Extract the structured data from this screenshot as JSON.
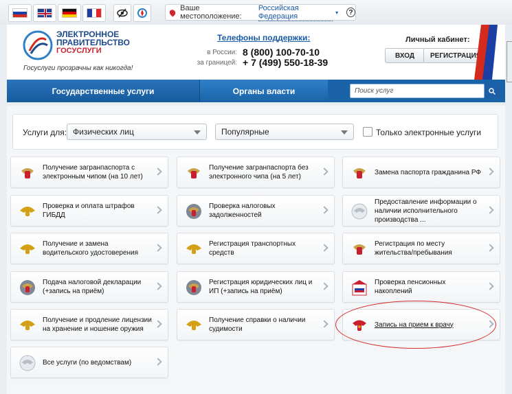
{
  "location": {
    "label": "Ваше местоположение:",
    "value": "Российская Федерация",
    "help": "?"
  },
  "logo": {
    "line1": "ЭЛЕКТРОННОЕ",
    "line2": "ПРАВИТЕЛЬСТВО",
    "line3": "ГОСУСЛУГИ",
    "slogan": "Госуслуги прозрачны как никогда!"
  },
  "support": {
    "title": "Телефоны поддержки:",
    "russia_label": "в России:",
    "russia_number": "8 (800) 100-70-10",
    "abroad_label": "за границей:",
    "abroad_number": "+ 7 (499) 550-18-39"
  },
  "cabinet": {
    "title": "Личный кабинет:",
    "login": "ВХОД",
    "register": "РЕГИСТРАЦИЯ"
  },
  "nav": {
    "services": "Государственные услуги",
    "authorities": "Органы власти",
    "search_placeholder": "Поиск услуг"
  },
  "filter": {
    "label": "Услуги для:",
    "audience": "Физических лиц",
    "sort": "Популярные",
    "electronic_only": "Только электронные услуги"
  },
  "services": [
    {
      "label": "Получение загранпаспорта с электронным чипом (на 10 лет)",
      "icon": "emblem-red"
    },
    {
      "label": "Получение загранпаспорта без электронного чипа (на 5 лет)",
      "icon": "emblem-red"
    },
    {
      "label": "Замена паспорта гражданина РФ",
      "icon": "emblem-red"
    },
    {
      "label": "Проверка и оплата штрафов ГИБДД",
      "icon": "emblem-gold"
    },
    {
      "label": "Проверка налоговых задолженностей",
      "icon": "emblem-tax"
    },
    {
      "label": "Предоставление информации о наличии исполнительного производства ...",
      "icon": "emblem-gray"
    },
    {
      "label": "Получение и замена водительского удостоверения",
      "icon": "emblem-gold"
    },
    {
      "label": "Регистрация транспортных средств",
      "icon": "emblem-gold"
    },
    {
      "label": "Регистрация по месту жительства/пребывания",
      "icon": "emblem-red"
    },
    {
      "label": "Подача налоговой декларации (+запись на приём)",
      "icon": "emblem-tax"
    },
    {
      "label": "Регистрация юридических лиц и ИП (+запись на приём)",
      "icon": "emblem-tax"
    },
    {
      "label": "Проверка пенсионных накоплений",
      "icon": "pension-fund"
    },
    {
      "label": "Получение и продление лицензии на хранение и ношение оружия",
      "icon": "emblem-gold"
    },
    {
      "label": "Получение справки о наличии судимости",
      "icon": "emblem-gold"
    },
    {
      "label": "Запись на прием к врачу",
      "icon": "emblem-health"
    },
    {
      "label": "Все услуги (по ведомствам)",
      "icon": "emblem-gray"
    }
  ]
}
